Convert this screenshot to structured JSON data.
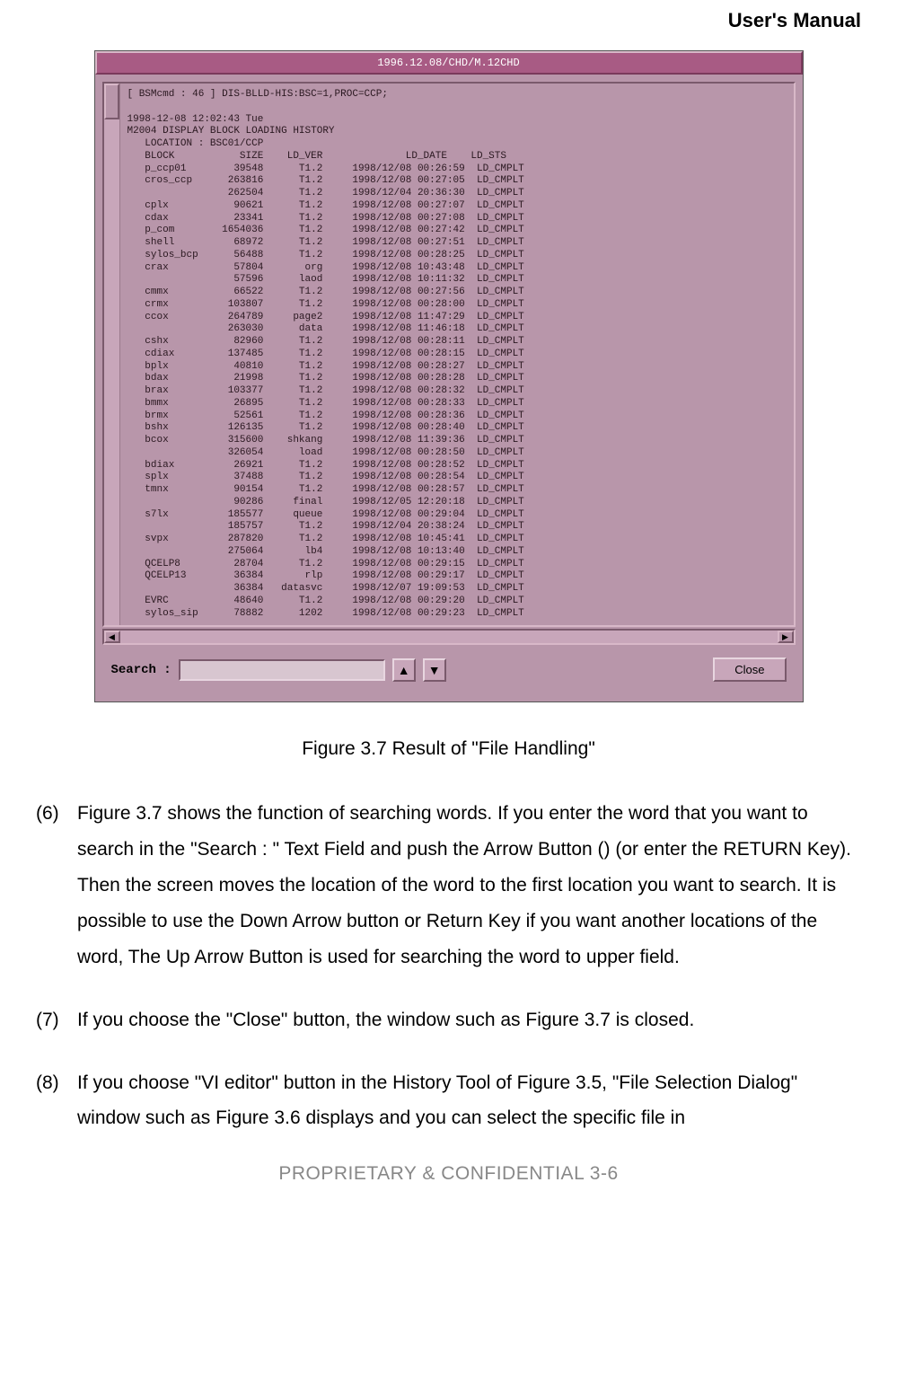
{
  "header": {
    "title": "User's Manual"
  },
  "window": {
    "titlebar": "1996.12.08/CHD/M.12CHD",
    "terminal_header": "[ BSMcmd : 46 ] DIS-BLLD-HIS:BSC=1,PROC=CCP;\n\n1998-12-08 12:02:43 Tue\nM2004 DISPLAY BLOCK LOADING HISTORY\n   LOCATION : BSC01/CCP",
    "columns": "   BLOCK           SIZE    LD_VER              LD_DATE    LD_STS",
    "rows": [
      "   p_ccp01        39548      T1.2     1998/12/08 00:26:59  LD_CMPLT",
      "   cros_ccp      263816      T1.2     1998/12/08 00:27:05  LD_CMPLT",
      "                 262504      T1.2     1998/12/04 20:36:30  LD_CMPLT",
      "   cplx           90621      T1.2     1998/12/08 00:27:07  LD_CMPLT",
      "   cdax           23341      T1.2     1998/12/08 00:27:08  LD_CMPLT",
      "   p_com        1654036      T1.2     1998/12/08 00:27:42  LD_CMPLT",
      "   shell          68972      T1.2     1998/12/08 00:27:51  LD_CMPLT",
      "   sylos_bcp      56488      T1.2     1998/12/08 00:28:25  LD_CMPLT",
      "   crax           57804       org     1998/12/08 10:43:48  LD_CMPLT",
      "                  57596      laod     1998/12/08 10:11:32  LD_CMPLT",
      "   cmmx           66522      T1.2     1998/12/08 00:27:56  LD_CMPLT",
      "   crmx          103807      T1.2     1998/12/08 00:28:00  LD_CMPLT",
      "   ccox          264789     page2     1998/12/08 11:47:29  LD_CMPLT",
      "                 263030      data     1998/12/08 11:46:18  LD_CMPLT",
      "   cshx           82960      T1.2     1998/12/08 00:28:11  LD_CMPLT",
      "   cdiax         137485      T1.2     1998/12/08 00:28:15  LD_CMPLT",
      "   bplx           40810      T1.2     1998/12/08 00:28:27  LD_CMPLT",
      "   bdax           21998      T1.2     1998/12/08 00:28:28  LD_CMPLT",
      "   brax          103377      T1.2     1998/12/08 00:28:32  LD_CMPLT",
      "   bmmx           26895      T1.2     1998/12/08 00:28:33  LD_CMPLT",
      "   brmx           52561      T1.2     1998/12/08 00:28:36  LD_CMPLT",
      "   bshx          126135      T1.2     1998/12/08 00:28:40  LD_CMPLT",
      "   bcox          315600    shkang     1998/12/08 11:39:36  LD_CMPLT",
      "                 326054      load     1998/12/08 00:28:50  LD_CMPLT",
      "   bdiax          26921      T1.2     1998/12/08 00:28:52  LD_CMPLT",
      "   splx           37488      T1.2     1998/12/08 00:28:54  LD_CMPLT",
      "   tmnx           90154      T1.2     1998/12/08 00:28:57  LD_CMPLT",
      "                  90286     final     1998/12/05 12:20:18  LD_CMPLT",
      "   s7lx          185577     queue     1998/12/08 00:29:04  LD_CMPLT",
      "                 185757      T1.2     1998/12/04 20:38:24  LD_CMPLT",
      "   svpx          287820      T1.2     1998/12/08 10:45:41  LD_CMPLT",
      "                 275064       lb4     1998/12/08 10:13:40  LD_CMPLT",
      "   QCELP8         28704      T1.2     1998/12/08 00:29:15  LD_CMPLT",
      "   QCELP13        36384       rlp     1998/12/08 00:29:17  LD_CMPLT",
      "                  36384   datasvc     1998/12/07 19:09:53  LD_CMPLT",
      "   EVRC           48640      T1.2     1998/12/08 00:29:20  LD_CMPLT",
      "   sylos_sip      78882      1202     1998/12/08 00:29:23  LD_CMPLT"
    ],
    "search_label": "Search :",
    "close_label": "Close"
  },
  "caption": "Figure 3.7 Result of \"File Handling\"",
  "items": [
    {
      "num": "(6)",
      "text": "Figure 3.7 shows the function of searching words. If you enter the word that you want to search in the \"Search : \" Text Field and push the Arrow Button () (or enter the RETURN Key). Then the screen moves the location of the word to the first location you want to search. It is possible to use the Down Arrow button or Return Key if you want another locations of the word, The Up Arrow Button is used for searching the word to upper field."
    },
    {
      "num": "(7)",
      "text": "If you choose the \"Close\" button, the window such as Figure 3.7 is closed."
    },
    {
      "num": "(8)",
      "text": "If you choose \"VI editor\" button in the History Tool of Figure 3.5, \"File Selection Dialog\" window such as Figure 3.6 displays and you can select the specific file in"
    }
  ],
  "footer": "PROPRIETARY & CONFIDENTIAL                3-6"
}
